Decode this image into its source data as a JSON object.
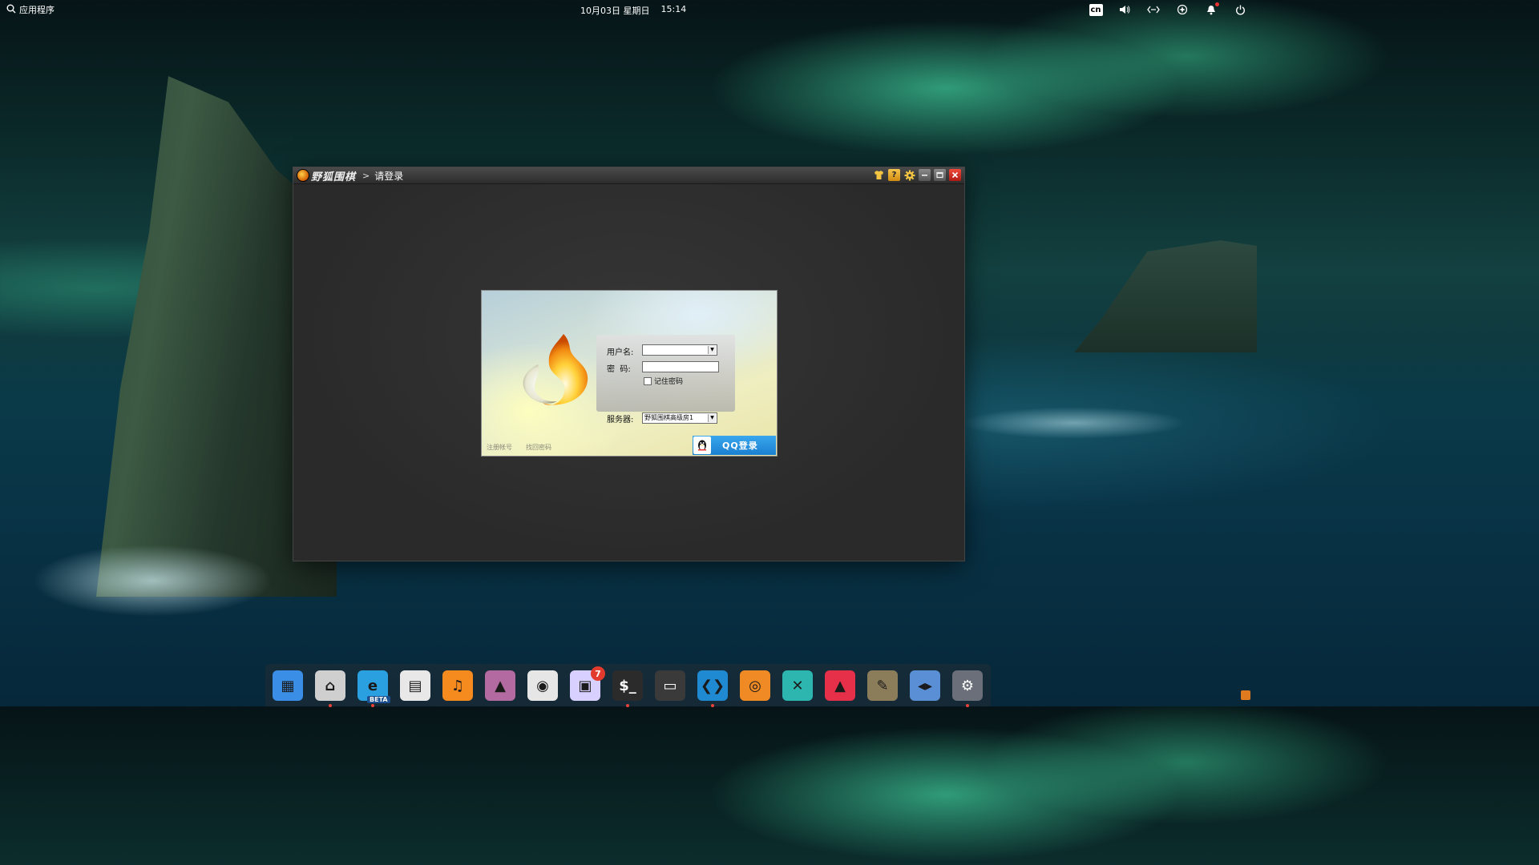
{
  "top_panel": {
    "apps_label": "应用程序",
    "date": "10月03日 星期日",
    "time": "15:14",
    "ime": "cn"
  },
  "window": {
    "app_name": "野狐围棋",
    "breadcrumb_sep": ">",
    "title": "请登录",
    "titlebar_icons": [
      "skin-icon",
      "help-icon",
      "settings-icon",
      "minimize-icon",
      "maximize-icon",
      "close-icon"
    ]
  },
  "login": {
    "username_label": "用户名:",
    "username_value": "",
    "password_label": "密  码:",
    "password_value": "",
    "remember_label": "记住密码",
    "remember_checked": false,
    "server_label": "服务器:",
    "server_value": "野狐围棋高级房1",
    "register_link": "注册帐号",
    "find_password_link": "找回密码",
    "qq_login_label": "QQ登录"
  },
  "dock": {
    "items": [
      {
        "name": "multitasking-view",
        "color": "#3a8ee6"
      },
      {
        "name": "file-manager",
        "color": "#cfcfcf"
      },
      {
        "name": "edge-browser-beta",
        "color": "#2aa0e0",
        "tag": "BETA"
      },
      {
        "name": "calendar",
        "color": "#e8e8e8"
      },
      {
        "name": "music",
        "color": "#f58a1f"
      },
      {
        "name": "image-viewer",
        "color": "#b36aa0"
      },
      {
        "name": "settings-toggle",
        "color": "#e6e6e6"
      },
      {
        "name": "app-store",
        "color": "#d8d0ff",
        "badge": "7"
      },
      {
        "name": "terminal",
        "color": "#2b2b2b"
      },
      {
        "name": "screenshot",
        "color": "#3a3a3a"
      },
      {
        "name": "vscode",
        "color": "#1f8ad2"
      },
      {
        "name": "blender",
        "color": "#f08a24"
      },
      {
        "name": "remote-desktop",
        "color": "#2db6b0"
      },
      {
        "name": "arrow-app",
        "color": "#e6304a"
      },
      {
        "name": "gimp",
        "color": "#8b7d5a"
      },
      {
        "name": "dev-tool",
        "color": "#5a8fd6"
      },
      {
        "name": "system-settings",
        "color": "#6a6f7a"
      }
    ]
  }
}
